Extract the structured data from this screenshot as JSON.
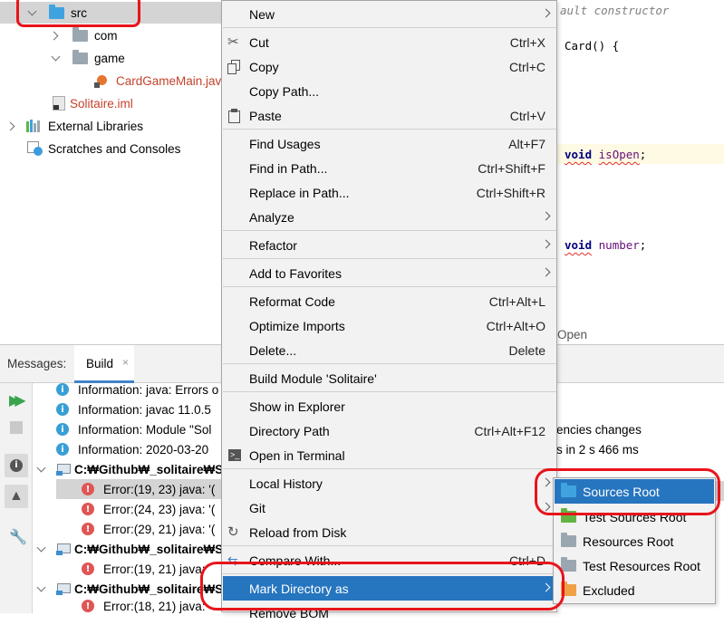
{
  "project_tree": {
    "items": [
      {
        "label": "src",
        "icon": "folder-blue-icon"
      },
      {
        "label": "com",
        "icon": "package-folder-icon"
      },
      {
        "label": "game",
        "icon": "package-folder-icon"
      },
      {
        "label": "CardGameMain.jav",
        "icon": "java-class-icon"
      },
      {
        "label": "Solitaire.iml",
        "icon": "module-file-icon"
      },
      {
        "label": "External Libraries",
        "icon": "libraries-icon"
      },
      {
        "label": "Scratches and Consoles",
        "icon": "scratches-icon"
      }
    ]
  },
  "editor": {
    "line1_comment": "ault constructor",
    "line2_text": "Card() {",
    "line3_kw": "void",
    "line3_ident": "isOpen",
    "line3_end": ";",
    "line4_kw": "void",
    "line4_ident": "number",
    "line4_end": ";",
    "partial_text": "Open"
  },
  "messages_panel": {
    "title": "Messages:",
    "tab_label": "Build",
    "right_text_1": "encies changes",
    "right_text_2": "s in 2 s 466 ms",
    "rows": [
      {
        "icon": "info-icon",
        "text": "Information: java: Errors o"
      },
      {
        "icon": "info-icon",
        "text": "Information: javac 11.0.5"
      },
      {
        "icon": "info-icon",
        "text": "Information: Module \"Sol"
      },
      {
        "icon": "info-icon",
        "text": "Information: 2020-03-20"
      },
      {
        "icon": "module-icon",
        "text": "C:₩Github₩_solitaire₩S"
      },
      {
        "icon": "error-icon",
        "text": "Error:(19, 23)  java: '("
      },
      {
        "icon": "error-icon",
        "text": "Error:(24, 23)  java: '("
      },
      {
        "icon": "error-icon",
        "text": "Error:(29, 21)  java: '("
      },
      {
        "icon": "module-icon",
        "text": "C:₩Github₩_solitaire₩S"
      },
      {
        "icon": "error-icon",
        "text": "Error:(19, 21)  java:"
      },
      {
        "icon": "module-icon",
        "text": "C:₩Github₩_solitaire₩S"
      },
      {
        "icon": "error-icon",
        "text": "Error:(18, 21)  java:"
      }
    ]
  },
  "context_menu": {
    "new": "New",
    "cut": "Cut",
    "cut_sc": "Ctrl+X",
    "copy": "Copy",
    "copy_sc": "Ctrl+C",
    "copy_path": "Copy Path...",
    "paste": "Paste",
    "paste_sc": "Ctrl+V",
    "find_usages": "Find Usages",
    "find_usages_sc": "Alt+F7",
    "find_in_path": "Find in Path...",
    "find_in_path_sc": "Ctrl+Shift+F",
    "replace_in_path": "Replace in Path...",
    "replace_in_path_sc": "Ctrl+Shift+R",
    "analyze": "Analyze",
    "refactor": "Refactor",
    "add_to_favorites": "Add to Favorites",
    "reformat_code": "Reformat Code",
    "reformat_code_sc": "Ctrl+Alt+L",
    "optimize_imports": "Optimize Imports",
    "optimize_imports_sc": "Ctrl+Alt+O",
    "delete": "Delete...",
    "delete_sc": "Delete",
    "build_module": "Build Module 'Solitaire'",
    "show_in_explorer": "Show in Explorer",
    "directory_path": "Directory Path",
    "directory_path_sc": "Ctrl+Alt+F12",
    "open_in_terminal": "Open in Terminal",
    "local_history": "Local History",
    "git": "Git",
    "reload_from_disk": "Reload from Disk",
    "compare_with": "Compare With...",
    "compare_with_sc": "Ctrl+D",
    "mark_directory_as": "Mark Directory as",
    "remove_bom": "Remove BOM"
  },
  "submenu": {
    "items": [
      {
        "label": "Sources Root",
        "icon": "sources-root-folder-icon",
        "color": "#40a3df"
      },
      {
        "label": "Test Sources Root",
        "icon": "test-sources-root-folder-icon",
        "color": "#62b543"
      },
      {
        "label": "Resources Root",
        "icon": "resources-root-folder-icon",
        "color": "#9aa7b0"
      },
      {
        "label": "Test Resources Root",
        "icon": "test-resources-root-folder-icon",
        "color": "#9aa7b0"
      },
      {
        "label": "Excluded",
        "icon": "excluded-folder-icon",
        "color": "#f0a045"
      }
    ]
  },
  "colors": {
    "menu_highlight": "#2675bf",
    "annotation_red": "#e8141b",
    "tree_selection": "#d4d4d4"
  }
}
